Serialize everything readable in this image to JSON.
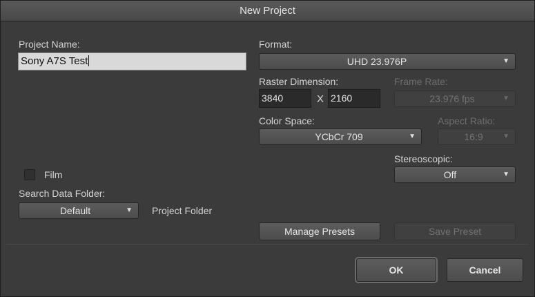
{
  "window": {
    "title": "New Project"
  },
  "project_name": {
    "label": "Project Name:",
    "value": "Sony A7S Test"
  },
  "format": {
    "label": "Format:",
    "value": "UHD 23.976P"
  },
  "raster": {
    "label": "Raster Dimension:",
    "width": "3840",
    "separator": "X",
    "height": "2160"
  },
  "frame_rate": {
    "label": "Frame Rate:",
    "value": "23.976 fps"
  },
  "color_space": {
    "label": "Color Space:",
    "value": "YCbCr 709"
  },
  "aspect_ratio": {
    "label": "Aspect Ratio:",
    "value": "16:9"
  },
  "stereoscopic": {
    "label": "Stereoscopic:",
    "value": "Off"
  },
  "film": {
    "label": "Film",
    "checked": false
  },
  "search_data_folder": {
    "label": "Search Data Folder:",
    "value": "Default",
    "folder_label": "Project Folder"
  },
  "buttons": {
    "manage_presets": "Manage Presets",
    "save_preset": "Save Preset",
    "ok": "OK",
    "cancel": "Cancel"
  },
  "icons": {
    "dropdown": "chevron-down-icon"
  }
}
